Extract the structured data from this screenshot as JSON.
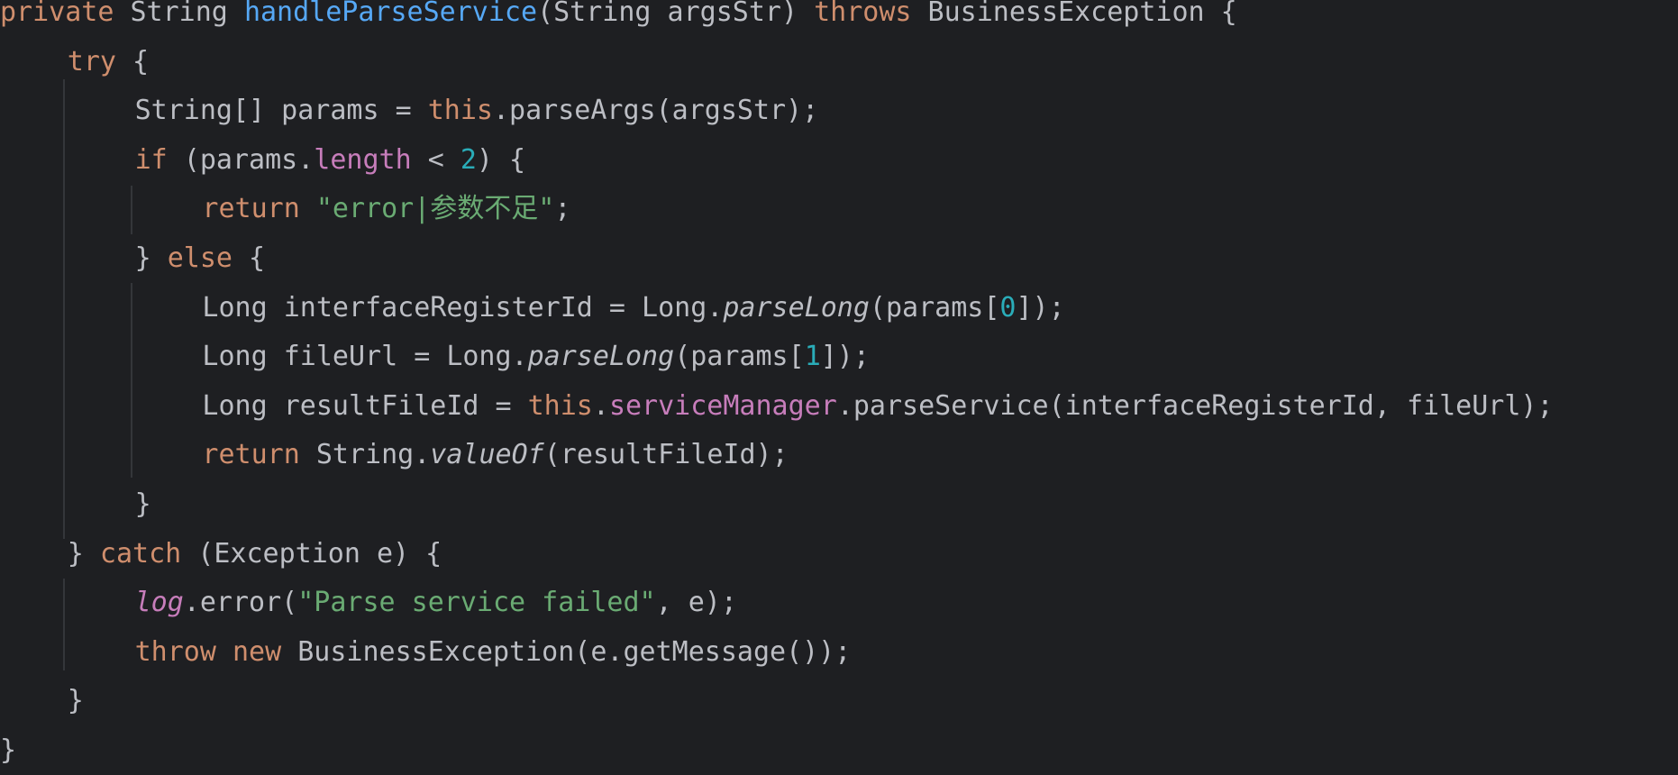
{
  "editor": {
    "theme": {
      "background": "#1e1f22",
      "default": "#bcbec4",
      "keyword": "#cf8e6d",
      "function": "#56a8f5",
      "field": "#c77dbb",
      "number": "#2aacb8",
      "string": "#6aab73",
      "guide": "#34363a"
    },
    "lines": [
      {
        "indent": 0,
        "tokens": [
          {
            "t": "private",
            "k": "kw"
          },
          {
            "t": " String "
          },
          {
            "t": "handleParseService",
            "k": "fn"
          },
          {
            "t": "(String argsStr) "
          },
          {
            "t": "throws",
            "k": "kw"
          },
          {
            "t": " BusinessException {"
          }
        ]
      },
      {
        "indent": 1,
        "tokens": [
          {
            "t": "try",
            "k": "kw"
          },
          {
            "t": " {"
          }
        ]
      },
      {
        "indent": 2,
        "tokens": [
          {
            "t": "String[] params = "
          },
          {
            "t": "this",
            "k": "kw"
          },
          {
            "t": ".parseArgs(argsStr);"
          }
        ]
      },
      {
        "indent": 2,
        "tokens": [
          {
            "t": "if",
            "k": "kw"
          },
          {
            "t": " (params."
          },
          {
            "t": "length",
            "k": "fld"
          },
          {
            "t": " < "
          },
          {
            "t": "2",
            "k": "num"
          },
          {
            "t": ") {"
          }
        ]
      },
      {
        "indent": 3,
        "tokens": [
          {
            "t": "return",
            "k": "kw"
          },
          {
            "t": " "
          },
          {
            "t": "\"error|参数不足\"",
            "k": "str"
          },
          {
            "t": ";"
          }
        ]
      },
      {
        "indent": 2,
        "tokens": [
          {
            "t": "} "
          },
          {
            "t": "else",
            "k": "kw"
          },
          {
            "t": " {"
          }
        ]
      },
      {
        "indent": 3,
        "tokens": [
          {
            "t": "Long interfaceRegisterId = Long."
          },
          {
            "t": "parseLong",
            "k": "it"
          },
          {
            "t": "(params["
          },
          {
            "t": "0",
            "k": "num"
          },
          {
            "t": "]);"
          }
        ]
      },
      {
        "indent": 3,
        "tokens": [
          {
            "t": "Long fileUrl = Long."
          },
          {
            "t": "parseLong",
            "k": "it"
          },
          {
            "t": "(params["
          },
          {
            "t": "1",
            "k": "num"
          },
          {
            "t": "]);"
          }
        ]
      },
      {
        "indent": 3,
        "tokens": [
          {
            "t": "Long resultFileId = "
          },
          {
            "t": "this",
            "k": "kw"
          },
          {
            "t": "."
          },
          {
            "t": "serviceManager",
            "k": "fld"
          },
          {
            "t": ".parseService(interfaceRegisterId, fileUrl);"
          }
        ]
      },
      {
        "indent": 3,
        "tokens": [
          {
            "t": "return",
            "k": "kw"
          },
          {
            "t": " String."
          },
          {
            "t": "valueOf",
            "k": "it"
          },
          {
            "t": "(resultFileId);"
          }
        ]
      },
      {
        "indent": 2,
        "tokens": [
          {
            "t": "}"
          }
        ]
      },
      {
        "indent": 1,
        "tokens": [
          {
            "t": "} "
          },
          {
            "t": "catch",
            "k": "kw"
          },
          {
            "t": " (Exception e) {"
          }
        ]
      },
      {
        "indent": 2,
        "tokens": [
          {
            "t": "log",
            "k": "fld-it"
          },
          {
            "t": ".error("
          },
          {
            "t": "\"Parse service failed\"",
            "k": "str"
          },
          {
            "t": ", e);"
          }
        ]
      },
      {
        "indent": 2,
        "tokens": [
          {
            "t": "throw",
            "k": "kw"
          },
          {
            "t": " "
          },
          {
            "t": "new",
            "k": "kw"
          },
          {
            "t": " BusinessException(e.getMessage());"
          }
        ]
      },
      {
        "indent": 1,
        "tokens": [
          {
            "t": "}"
          }
        ]
      },
      {
        "indent": 0,
        "tokens": [
          {
            "t": "}"
          }
        ]
      }
    ]
  }
}
